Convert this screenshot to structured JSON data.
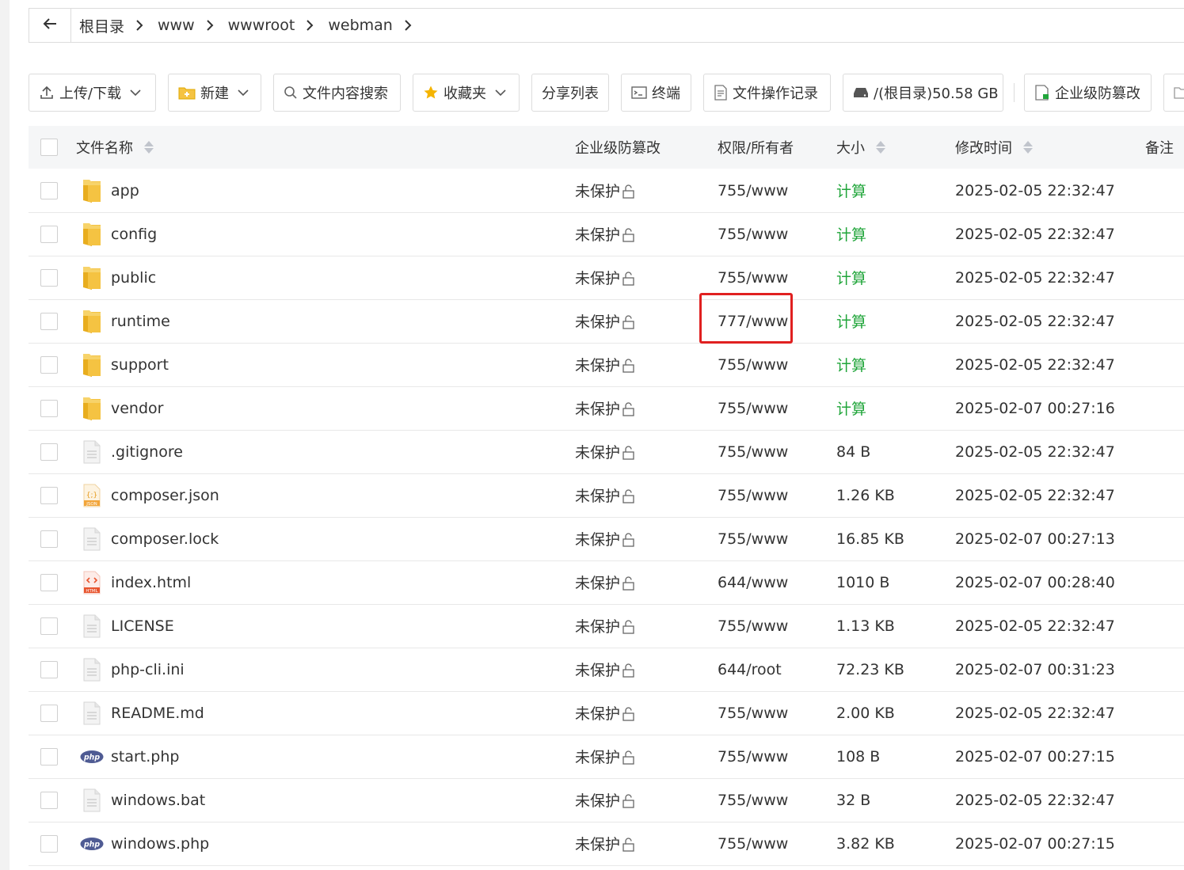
{
  "breadcrumb": {
    "items": [
      "根目录",
      "www",
      "wwwroot",
      "webman"
    ]
  },
  "toolbar": {
    "upload_download": "上传/下载",
    "new": "新建",
    "content_search": "文件内容搜索",
    "favorites": "收藏夹",
    "share_list": "分享列表",
    "terminal": "终端",
    "operation_log": "文件操作记录",
    "disk": "/(根目录)50.58 GB",
    "tamper_protect": "企业级防篡改"
  },
  "table": {
    "headers": {
      "name": "文件名称",
      "tamper": "企业级防篡改",
      "perm_owner": "权限/所有者",
      "size": "大小",
      "mtime": "修改时间",
      "remark": "备注"
    },
    "rows": [
      {
        "icon": "folder-icon",
        "name": "app",
        "protection": "未保护",
        "perm": "755/www",
        "size": "计算",
        "mtime": "2025-02-05 22:32:47"
      },
      {
        "icon": "folder-icon",
        "name": "config",
        "protection": "未保护",
        "perm": "755/www",
        "size": "计算",
        "mtime": "2025-02-05 22:32:47"
      },
      {
        "icon": "folder-icon",
        "name": "public",
        "protection": "未保护",
        "perm": "755/www",
        "size": "计算",
        "mtime": "2025-02-05 22:32:47"
      },
      {
        "icon": "folder-icon",
        "name": "runtime",
        "protection": "未保护",
        "perm": "777/www",
        "size": "计算",
        "mtime": "2025-02-05 22:32:47"
      },
      {
        "icon": "folder-icon",
        "name": "support",
        "protection": "未保护",
        "perm": "755/www",
        "size": "计算",
        "mtime": "2025-02-05 22:32:47"
      },
      {
        "icon": "folder-icon",
        "name": "vendor",
        "protection": "未保护",
        "perm": "755/www",
        "size": "计算",
        "mtime": "2025-02-07 00:27:16"
      },
      {
        "icon": "text-file-icon",
        "name": ".gitignore",
        "protection": "未保护",
        "perm": "755/www",
        "size": "84 B",
        "mtime": "2025-02-05 22:32:47"
      },
      {
        "icon": "json-file-icon",
        "name": "composer.json",
        "protection": "未保护",
        "perm": "755/www",
        "size": "1.26 KB",
        "mtime": "2025-02-05 22:32:47"
      },
      {
        "icon": "text-file-icon",
        "name": "composer.lock",
        "protection": "未保护",
        "perm": "755/www",
        "size": "16.85 KB",
        "mtime": "2025-02-07 00:27:13"
      },
      {
        "icon": "html-file-icon",
        "name": "index.html",
        "protection": "未保护",
        "perm": "644/www",
        "size": "1010 B",
        "mtime": "2025-02-07 00:28:40"
      },
      {
        "icon": "text-file-icon",
        "name": "LICENSE",
        "protection": "未保护",
        "perm": "755/www",
        "size": "1.13 KB",
        "mtime": "2025-02-05 22:32:47"
      },
      {
        "icon": "text-file-icon",
        "name": "php-cli.ini",
        "protection": "未保护",
        "perm": "644/root",
        "size": "72.23 KB",
        "mtime": "2025-02-07 00:31:23"
      },
      {
        "icon": "text-file-icon",
        "name": "README.md",
        "protection": "未保护",
        "perm": "755/www",
        "size": "2.00 KB",
        "mtime": "2025-02-05 22:32:47"
      },
      {
        "icon": "php-file-icon",
        "name": "start.php",
        "protection": "未保护",
        "perm": "755/www",
        "size": "108 B",
        "mtime": "2025-02-07 00:27:15"
      },
      {
        "icon": "text-file-icon",
        "name": "windows.bat",
        "protection": "未保护",
        "perm": "755/www",
        "size": "32 B",
        "mtime": "2025-02-05 22:32:47"
      },
      {
        "icon": "php-file-icon",
        "name": "windows.php",
        "protection": "未保护",
        "perm": "755/www",
        "size": "3.82 KB",
        "mtime": "2025-02-07 00:27:15"
      }
    ]
  },
  "colors": {
    "calc_link": "#20a53a",
    "highlight": "#e02020",
    "folder": "#f5c342"
  }
}
